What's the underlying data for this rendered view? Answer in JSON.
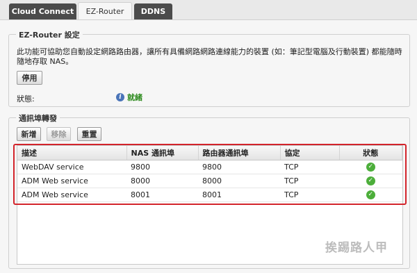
{
  "tabs": [
    {
      "label": "Cloud Connect"
    },
    {
      "label": "EZ-Router"
    },
    {
      "label": "DDNS"
    }
  ],
  "ez_router": {
    "legend": "EZ-Router 設定",
    "description": "此功能可協助您自動設定網路路由器，讓所有具備網路網路連線能力的裝置 (如：筆記型電腦及行動裝置) 都能隨時隨地存取 NAS。",
    "disable_button": "停用",
    "status_label": "狀態:",
    "status_value": "就緒",
    "status_color": "#2e8b1f"
  },
  "port_forwarding": {
    "legend": "通訊埠轉發",
    "buttons": {
      "add": "新增",
      "remove": "移除",
      "reset": "重置"
    },
    "columns": [
      "描述",
      "NAS 通訊埠",
      "路由器通訊埠",
      "協定",
      "狀態"
    ],
    "rows": [
      {
        "description": "WebDAV service",
        "nas_port": "9800",
        "router_port": "9800",
        "protocol": "TCP",
        "status_icon": "check-circle-icon"
      },
      {
        "description": "ADM Web service",
        "nas_port": "8000",
        "router_port": "8000",
        "protocol": "TCP",
        "status_icon": "check-circle-icon"
      },
      {
        "description": "ADM Web service",
        "nas_port": "8001",
        "router_port": "8001",
        "protocol": "TCP",
        "status_icon": "check-circle-icon"
      }
    ]
  },
  "watermark": "挨踢路人甲",
  "colors": {
    "highlight": "#d3242b",
    "ok": "#4cae3a",
    "tab_dark": "#4b4b4b"
  }
}
